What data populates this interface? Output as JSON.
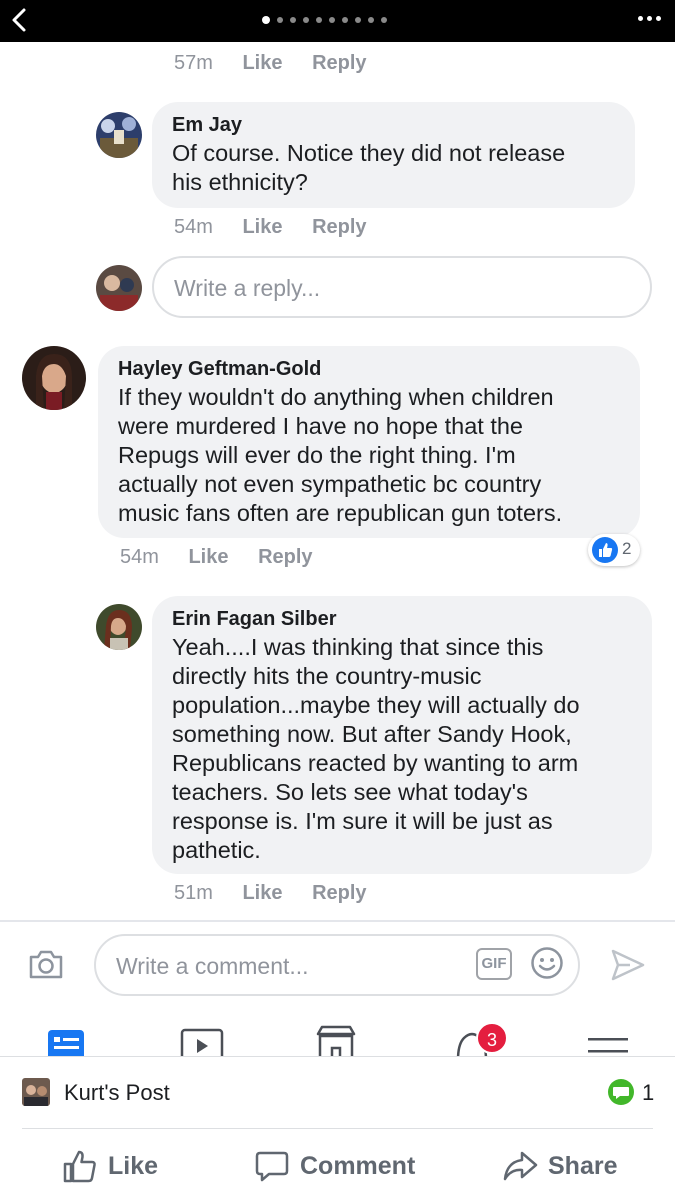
{
  "topbar": {
    "back_icon": "chevron-left-icon",
    "page_dots": 10,
    "active_dot": 0,
    "more_icon": "ellipsis-icon"
  },
  "comments": [
    {
      "time": "57m",
      "like": "Like",
      "reply": "Reply"
    },
    {
      "name": "Em Jay",
      "text_lines": [
        "Of course. Notice they did not release",
        "his ethnicity?"
      ],
      "time": "54m",
      "like": "Like",
      "reply": "Reply"
    },
    {
      "name": "Hayley Geftman-Gold",
      "text_lines": [
        "If they wouldn't do anything when children",
        "were murdered I have no hope that the",
        "Repugs will ever do the right thing.  I'm",
        "actually not even sympathetic bc country",
        "music fans often are republican gun toters."
      ],
      "time": "54m",
      "like": "Like",
      "reply": "Reply",
      "reaction_count": "2"
    },
    {
      "name": "Erin Fagan Silber",
      "text_lines": [
        "Yeah....I was thinking that since this",
        "directly hits the country-music",
        "population...maybe they will actually do",
        "something now.  But after Sandy Hook,",
        "Republicans reacted by wanting to arm",
        "teachers.  So lets see what today's",
        "response is.  I'm sure it will be just as",
        "pathetic."
      ],
      "time": "51m",
      "like": "Like",
      "reply": "Reply"
    }
  ],
  "reply_box": {
    "placeholder": "Write a reply..."
  },
  "composer": {
    "placeholder": "Write a comment...",
    "gif_label": "GIF"
  },
  "tabbar": {
    "notification_badge": "3"
  },
  "post_bar": {
    "title": "Kurt's Post",
    "comment_count": "1"
  },
  "actions": {
    "like": "Like",
    "comment": "Comment",
    "share": "Share"
  },
  "colors": {
    "accent": "#1877f2",
    "badge": "#e41e3f",
    "comment_badge": "#42b72a",
    "bubble": "#f1f2f4",
    "muted": "#90949c"
  }
}
